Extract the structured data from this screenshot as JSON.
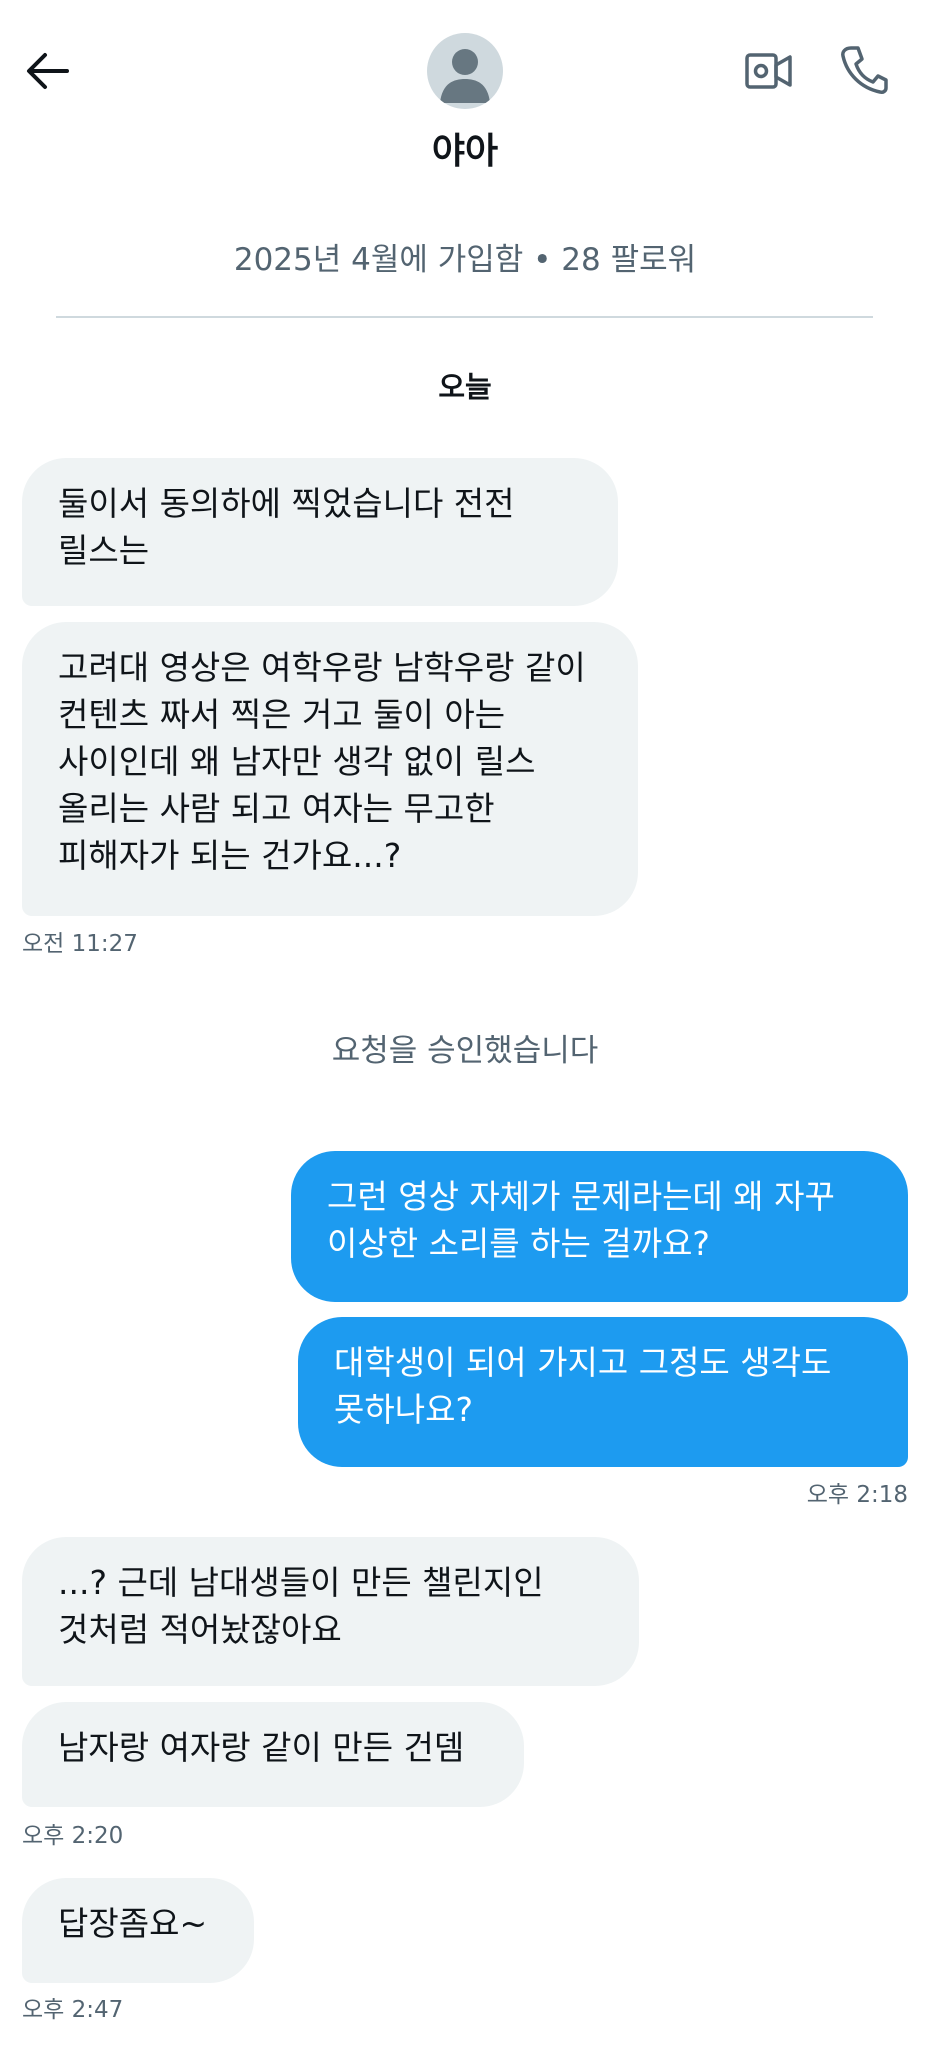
{
  "header": {
    "back_icon": "arrow-left-icon",
    "avatar_icon": "default-avatar-icon",
    "name": "야아",
    "video_icon": "video-camera-icon",
    "call_icon": "phone-icon"
  },
  "profile": {
    "meta": "2025년 4월에 가입함 • 28 팔로워"
  },
  "date_separator": "오늘",
  "messages": {
    "m1": "둘이서 동의하에 찍었습니다 전전 릴스는",
    "m2": "고려대 영상은 여학우랑 남학우랑 같이 컨텐츠 짜서 찍은 거고 둘이 아는 사이인데 왜 남자만 생각 없이 릴스 올리는 사람 되고 여자는 무고한 피해자가 되는 건가요...?",
    "t1": "오전 11:27",
    "system": "요청을 승인했습니다",
    "m3": "그런 영상 자체가 문제라는데 왜 자꾸 이상한 소리를 하는 걸까요?",
    "m4": "대학생이 되어 가지고 그정도 생각도 못하나요?",
    "t2": "오후 2:18",
    "m5": "...? 근데 남대생들이 만든 챌린지인 것처럼 적어놨잖아요",
    "m6": "남자랑 여자랑 같이 만든 건뎀",
    "t3": "오후 2:20",
    "m7": "답장좀요~",
    "t4": "오후 2:47"
  },
  "colors": {
    "outgoing_bubble": "#1d9bf0",
    "incoming_bubble": "#eff3f4",
    "secondary_text": "#536471"
  }
}
